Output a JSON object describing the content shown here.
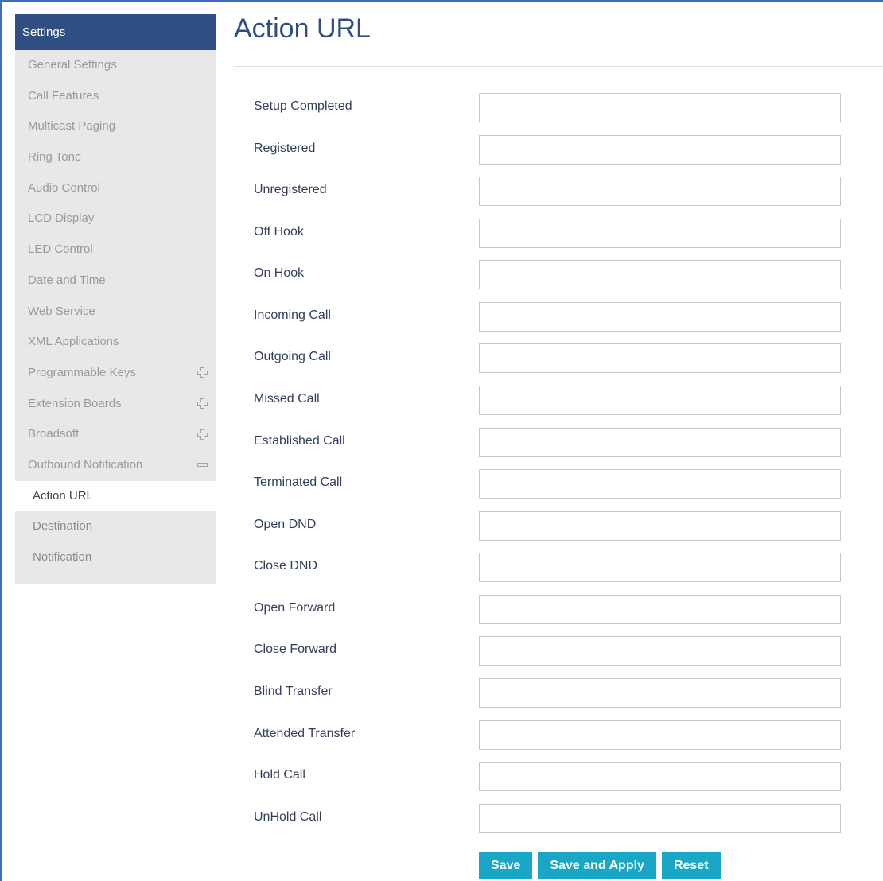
{
  "sidebar": {
    "header": "Settings",
    "items": [
      {
        "label": "General Settings",
        "toggle": ""
      },
      {
        "label": "Call Features",
        "toggle": ""
      },
      {
        "label": "Multicast Paging",
        "toggle": ""
      },
      {
        "label": "Ring Tone",
        "toggle": ""
      },
      {
        "label": "Audio Control",
        "toggle": ""
      },
      {
        "label": "LCD Display",
        "toggle": ""
      },
      {
        "label": "LED Control",
        "toggle": ""
      },
      {
        "label": "Date and Time",
        "toggle": ""
      },
      {
        "label": "Web Service",
        "toggle": ""
      },
      {
        "label": "XML Applications",
        "toggle": ""
      },
      {
        "label": "Programmable Keys",
        "toggle": "plus-icon"
      },
      {
        "label": "Extension Boards",
        "toggle": "plus-icon"
      },
      {
        "label": "Broadsoft",
        "toggle": "plus-icon"
      },
      {
        "label": "Outbound Notification",
        "toggle": "minus-icon"
      }
    ],
    "subitems": [
      {
        "label": "Action URL",
        "active": true
      },
      {
        "label": "Destination",
        "active": false
      },
      {
        "label": "Notification",
        "active": false
      }
    ]
  },
  "main": {
    "title": "Action URL",
    "fields": [
      {
        "label": "Setup Completed",
        "value": ""
      },
      {
        "label": "Registered",
        "value": ""
      },
      {
        "label": "Unregistered",
        "value": ""
      },
      {
        "label": "Off Hook",
        "value": ""
      },
      {
        "label": "On Hook",
        "value": ""
      },
      {
        "label": "Incoming Call",
        "value": ""
      },
      {
        "label": "Outgoing Call",
        "value": ""
      },
      {
        "label": "Missed Call",
        "value": ""
      },
      {
        "label": "Established Call",
        "value": ""
      },
      {
        "label": "Terminated Call",
        "value": ""
      },
      {
        "label": "Open DND",
        "value": ""
      },
      {
        "label": "Close DND",
        "value": ""
      },
      {
        "label": "Open Forward",
        "value": ""
      },
      {
        "label": "Close Forward",
        "value": ""
      },
      {
        "label": "Blind Transfer",
        "value": ""
      },
      {
        "label": "Attended Transfer",
        "value": ""
      },
      {
        "label": "Hold Call",
        "value": ""
      },
      {
        "label": "UnHold Call",
        "value": ""
      }
    ],
    "buttons": {
      "save": "Save",
      "save_apply": "Save and Apply",
      "reset": "Reset"
    }
  },
  "colors": {
    "sidebar_header": "#2f4f82",
    "sidebar_bg": "#e8e8e8",
    "title": "#2f4f82",
    "button": "#1aa6c7",
    "frame_border": "#3e6bc7"
  }
}
